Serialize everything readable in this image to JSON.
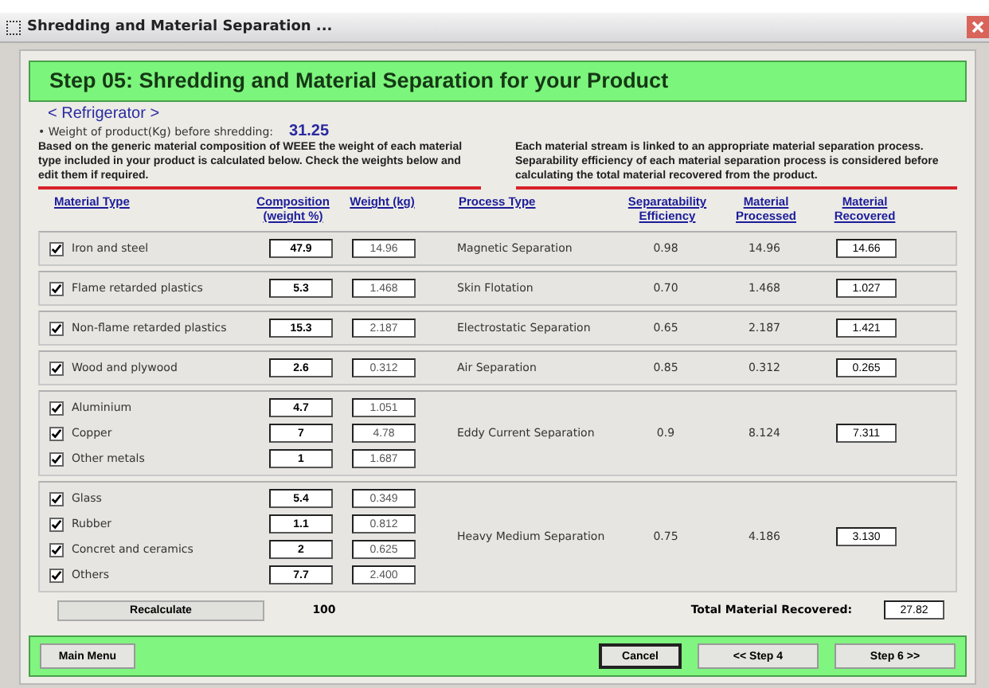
{
  "window": {
    "title": "Shredding and Material Separation ..."
  },
  "header": "Step 05: Shredding and Material Separation for your Product",
  "product": "< Refrigerator >",
  "weight_label": "• Weight of product(Kg) before shredding:",
  "weight_value": "31.25",
  "intro_left": "Based on the generic material composition of WEEE the weight of each material type included in your product is calculated below. Check the weights below and edit them if required.",
  "intro_right": "Each material stream is linked to an appropriate material separation process. Separability efficiency of each material separation process is considered before calculating the total material recovered from the product.",
  "columns": [
    "Material Type",
    "Composition\n(weight %)",
    "Weight (kg)",
    "Process Type",
    "Separatability\nEfficiency",
    "Material\nProcessed",
    "Material\nRecovered"
  ],
  "groups": [
    {
      "materials": [
        {
          "name": "Iron and steel",
          "checked": true,
          "composition": "47.9",
          "weight": "14.96"
        }
      ],
      "process": {
        "type": "Magnetic Separation",
        "efficiency": "0.98",
        "processed": "14.96",
        "recovered": "14.66"
      }
    },
    {
      "materials": [
        {
          "name": "Flame retarded plastics",
          "checked": true,
          "composition": "5.3",
          "weight": "1.468"
        }
      ],
      "process": {
        "type": "Skin Flotation",
        "efficiency": "0.70",
        "processed": "1.468",
        "recovered": "1.027"
      }
    },
    {
      "materials": [
        {
          "name": "Non-flame retarded plastics",
          "checked": true,
          "composition": "15.3",
          "weight": "2.187"
        }
      ],
      "process": {
        "type": "Electrostatic Separation",
        "efficiency": "0.65",
        "processed": "2.187",
        "recovered": "1.421"
      }
    },
    {
      "materials": [
        {
          "name": "Wood and plywood",
          "checked": true,
          "composition": "2.6",
          "weight": "0.312"
        }
      ],
      "process": {
        "type": "Air Separation",
        "efficiency": "0.85",
        "processed": "0.312",
        "recovered": "0.265"
      }
    },
    {
      "materials": [
        {
          "name": "Aluminium",
          "checked": true,
          "composition": "4.7",
          "weight": "1.051"
        },
        {
          "name": "Copper",
          "checked": true,
          "composition": "7",
          "weight": "4.78"
        },
        {
          "name": "Other metals",
          "checked": true,
          "composition": "1",
          "weight": "1.687"
        }
      ],
      "process": {
        "type": "Eddy Current Separation",
        "efficiency": "0.9",
        "processed": "8.124",
        "recovered": "7.311"
      }
    },
    {
      "materials": [
        {
          "name": "Glass",
          "checked": true,
          "composition": "5.4",
          "weight": "0.349"
        },
        {
          "name": "Rubber",
          "checked": true,
          "composition": "1.1",
          "weight": "0.812"
        },
        {
          "name": "Concret and ceramics",
          "checked": true,
          "composition": "2",
          "weight": "0.625"
        },
        {
          "name": "Others",
          "checked": true,
          "composition": "7.7",
          "weight": "2.400"
        }
      ],
      "process": {
        "type": "Heavy Medium Separation",
        "efficiency": "0.75",
        "processed": "4.186",
        "recovered": "3.130"
      }
    }
  ],
  "recalculate": "Recalculate",
  "composition_total": "100",
  "total_label": "Total Material Recovered:",
  "total_value": "27.82",
  "buttons": {
    "main_menu": "Main Menu",
    "cancel": "Cancel",
    "back": "<< Step 4",
    "next": "Step 6 >>"
  }
}
